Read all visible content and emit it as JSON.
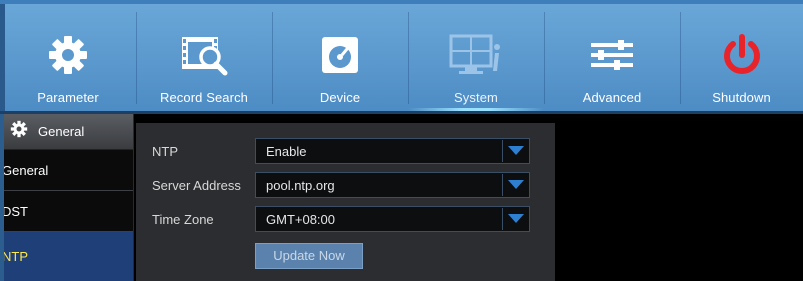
{
  "nav": {
    "tabs": [
      {
        "label": "Parameter",
        "icon": "gear-icon"
      },
      {
        "label": "Record Search",
        "icon": "record-search-icon"
      },
      {
        "label": "Device",
        "icon": "hard-disk-icon"
      },
      {
        "label": "System",
        "icon": "monitor-info-icon"
      },
      {
        "label": "Advanced",
        "icon": "sliders-icon"
      },
      {
        "label": "Shutdown",
        "icon": "power-icon"
      }
    ],
    "active_tab": "System"
  },
  "sidebar": {
    "header": "General",
    "items": [
      {
        "label": "General"
      },
      {
        "label": "DST"
      },
      {
        "label": "NTP"
      }
    ],
    "active_item": "NTP"
  },
  "form": {
    "ntp": {
      "label": "NTP",
      "value": "Enable"
    },
    "server_address": {
      "label": "Server Address",
      "value": "pool.ntp.org"
    },
    "time_zone": {
      "label": "Time Zone",
      "value": "GMT+08:00"
    },
    "update_button": "Update Now"
  },
  "colors": {
    "nav_blue": "#5a98cd",
    "active_sidebar": "#1f3f78",
    "active_text": "#ffe84a",
    "power_red": "#e8242a",
    "button_blue": "#5a82ad"
  }
}
